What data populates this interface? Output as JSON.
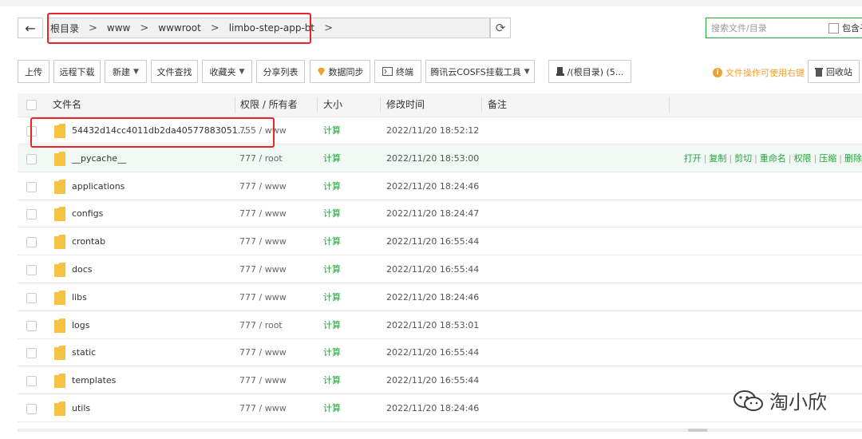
{
  "path": {
    "back_label": "←",
    "crumbs": [
      "根目录",
      "www",
      "wwwroot",
      "limbo-step-app-bt"
    ],
    "separator": ">",
    "refresh_label": "⟳"
  },
  "search": {
    "placeholder": "搜索文件/目录",
    "include_sub_label": "包含子"
  },
  "toolbar": {
    "upload": "上传",
    "remote_download": "远程下载",
    "new": "新建",
    "file_search": "文件查找",
    "favorites": "收藏夹",
    "share_list": "分享列表",
    "data_sync": "数据同步",
    "terminal": "终端",
    "cosfs": "腾讯云COSFS挂载工具",
    "disk": "/(根目录) (5...",
    "tip": "文件操作可使用右键",
    "recycle": "回收站"
  },
  "table": {
    "headers": {
      "name": "文件名",
      "perm": "权限 / 所有者",
      "size": "大小",
      "mtime": "修改时间",
      "note": "备注"
    },
    "rows": [
      {
        "name": "54432d14cc4011db2da40577883051...",
        "perm": "755 / www",
        "size": "计算",
        "mtime": "2022/11/20 18:52:12"
      },
      {
        "name": "__pycache__",
        "perm": "777 / root",
        "size": "计算",
        "mtime": "2022/11/20 18:53:00"
      },
      {
        "name": "applications",
        "perm": "777 / www",
        "size": "计算",
        "mtime": "2022/11/20 18:24:46"
      },
      {
        "name": "configs",
        "perm": "777 / www",
        "size": "计算",
        "mtime": "2022/11/20 18:24:47"
      },
      {
        "name": "crontab",
        "perm": "777 / www",
        "size": "计算",
        "mtime": "2022/11/20 16:55:44"
      },
      {
        "name": "docs",
        "perm": "777 / www",
        "size": "计算",
        "mtime": "2022/11/20 16:55:44"
      },
      {
        "name": "libs",
        "perm": "777 / www",
        "size": "计算",
        "mtime": "2022/11/20 18:24:46"
      },
      {
        "name": "logs",
        "perm": "777 / root",
        "size": "计算",
        "mtime": "2022/11/20 18:53:01"
      },
      {
        "name": "static",
        "perm": "777 / www",
        "size": "计算",
        "mtime": "2022/11/20 16:55:44"
      },
      {
        "name": "templates",
        "perm": "777 / www",
        "size": "计算",
        "mtime": "2022/11/20 16:55:44"
      },
      {
        "name": "utils",
        "perm": "777 / www",
        "size": "计算",
        "mtime": "2022/11/20 18:24:46"
      }
    ],
    "row_actions": [
      "打开",
      "复制",
      "剪切",
      "重命名",
      "权限",
      "压缩",
      "删除"
    ]
  },
  "watermark": {
    "text": "淘小欣"
  },
  "colors": {
    "accent": "#20a53a",
    "annotation": "#e5252a",
    "warning": "#f0a030",
    "folder": "#f7c242"
  }
}
